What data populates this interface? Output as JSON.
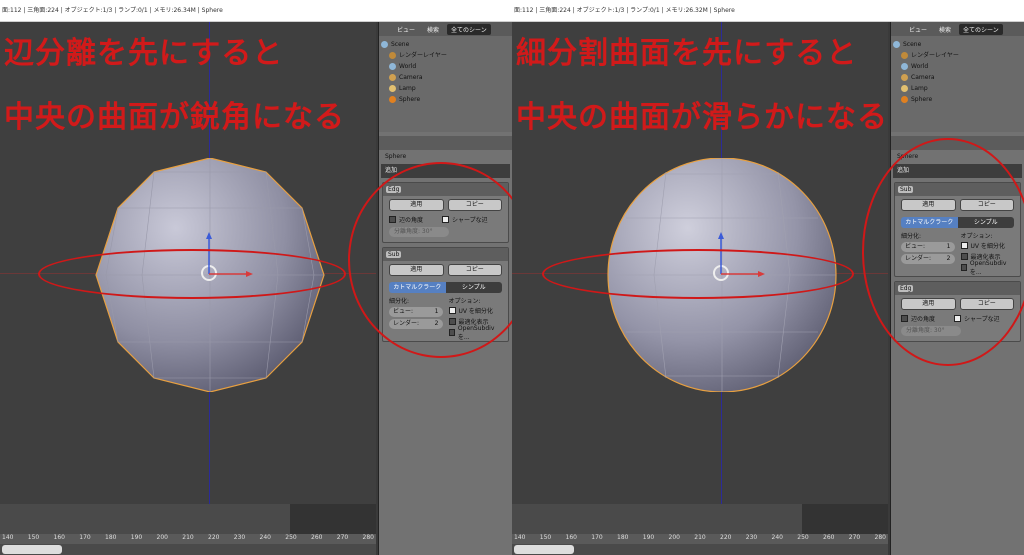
{
  "colors": {
    "annotation": "#d11a1a",
    "accent": "#5680c2"
  },
  "left": {
    "statusbar": "面:112 | 三角面:224 | オブジェクト:1/3 | ランプ:0/1 | メモリ:26.34M | Sphere",
    "annotation_line1": "辺分離を先にすると",
    "annotation_line2": "中央の曲面が鋭角になる",
    "tabs": [
      "ビュー",
      "検索",
      "全てのシーン"
    ],
    "outliner": [
      "Scene",
      "レンダーレイヤー",
      "World",
      "Camera",
      "Lamp",
      "Sphere"
    ],
    "breadcrumb": "Sphere",
    "modlist_label": "追加",
    "mod1": {
      "name": "Edg",
      "apply": "適用",
      "copy": "コピー",
      "edge_angle": "辺の角度",
      "sharp": "シャープな辺",
      "split_angle": "分離角度: 30°"
    },
    "mod2": {
      "name": "Sub",
      "apply": "適用",
      "copy": "コピー",
      "catmull": "カトマルクラーク",
      "simple": "シンプル",
      "subdiv_label": "細分化:",
      "options_label": "オプション:",
      "view": "ビュー:",
      "view_val": "1",
      "render": "レンダー:",
      "render_val": "2",
      "uv": "UV を細分化",
      "optimal": "最適化表示",
      "opensubdiv": "OpenSubdiv を..."
    }
  },
  "right": {
    "statusbar": "面:112 | 三角面:224 | オブジェクト:1/3 | ランプ:0/1 | メモリ:26.32M | Sphere",
    "annotation_line1": "細分割曲面を先にすると",
    "annotation_line2": "中央の曲面が滑らかになる",
    "tabs": [
      "ビュー",
      "検索",
      "全てのシーン"
    ],
    "outliner": [
      "Scene",
      "レンダーレイヤー",
      "World",
      "Camera",
      "Lamp",
      "Sphere"
    ],
    "breadcrumb": "Sphere",
    "modlist_label": "追加",
    "mod1": {
      "name": "Sub",
      "apply": "適用",
      "copy": "コピー",
      "catmull": "カトマルクラーク",
      "simple": "シンプル",
      "subdiv_label": "細分化:",
      "options_label": "オプション:",
      "view": "ビュー:",
      "view_val": "1",
      "render": "レンダー:",
      "render_val": "2",
      "uv": "UV を細分化",
      "optimal": "最適化表示",
      "opensubdiv": "OpenSubdiv を..."
    },
    "mod2": {
      "name": "Edg",
      "apply": "適用",
      "copy": "コピー",
      "edge_angle": "辺の角度",
      "sharp": "シャープな辺",
      "split_angle": "分離角度: 30°"
    }
  },
  "ruler": [
    "140",
    "150",
    "160",
    "170",
    "180",
    "190",
    "200",
    "210",
    "220",
    "230",
    "240",
    "250",
    "260",
    "270",
    "280"
  ]
}
